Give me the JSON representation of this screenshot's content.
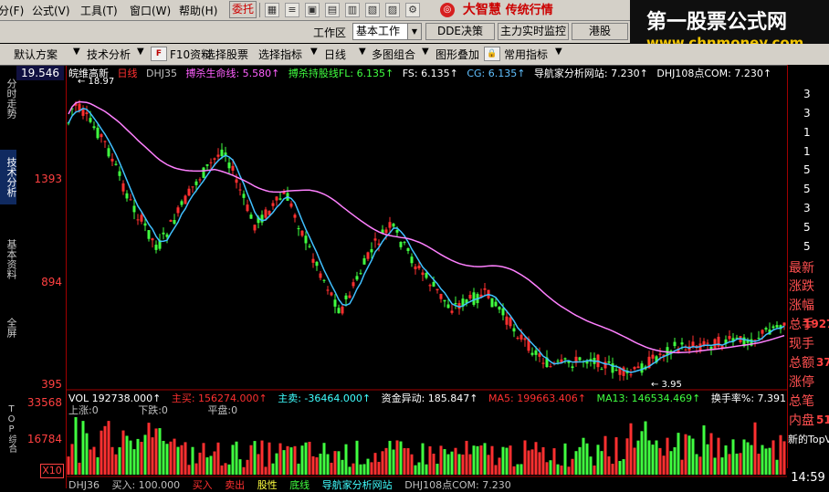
{
  "menu": {
    "items": [
      "分(F)",
      "公式(V)",
      "工具(T)",
      "窗口(W)",
      "帮助(H)"
    ],
    "commission_button": "委托",
    "brand_name": "大智慧",
    "brand_slogan": "传统行情"
  },
  "banner": {
    "title": "第一股票公式网",
    "url": "www.chnmoney.com"
  },
  "row2": {
    "workspace_label": "工作区",
    "workspace_value": "基本工作",
    "buttons": [
      "DDE决策",
      "主力实时监控",
      "港股"
    ]
  },
  "toolbar": {
    "items": [
      "默认方案",
      "技术分析",
      "F10资料",
      "选择股票",
      "选择指标",
      "日线",
      "多图组合",
      "图形叠加",
      "常用指标"
    ]
  },
  "sidebar": {
    "tabs": [
      "分时走势",
      "技术分析",
      "基本资料",
      "全屏",
      "TOP综合"
    ]
  },
  "yaxis": {
    "price_top": "19.546",
    "price_labels": [
      "1393",
      "894",
      "395"
    ],
    "vol_labels": [
      "33568",
      "16784"
    ],
    "vol_unit": "X10"
  },
  "info": {
    "stock_name": "皖维高新",
    "period": "日线",
    "indicator": "DHJ35",
    "lines": [
      {
        "text": "搏杀生命线: 5.580↑",
        "color": "#ff60ff"
      },
      {
        "text": "搏杀持股线FL: 6.135↑",
        "color": "#40ff40"
      },
      {
        "text": "FS: 6.135↑",
        "color": "#ffffff"
      },
      {
        "text": "CG: 6.135↑",
        "color": "#60c0ff"
      },
      {
        "text": "导航家分析网站: 7.230↑",
        "color": "#ffffff"
      },
      {
        "text": "DHJ108点COM: 7.230↑",
        "color": "#ffffff"
      }
    ],
    "high_marker": "18.97",
    "low_marker": "3.95"
  },
  "volume": {
    "lines": [
      {
        "text": "VOL 192738.000↑",
        "color": "#ffffff"
      },
      {
        "text": "主买: 156274.000↑",
        "color": "#ff3030"
      },
      {
        "text": "主卖: -36464.000↑",
        "color": "#40ffff"
      },
      {
        "text": "资金异动: 185.847↑",
        "color": "#ffffff"
      },
      {
        "text": "MA5: 199663.406↑",
        "color": "#ff3030"
      },
      {
        "text": "MA13: 146534.469↑",
        "color": "#40ff40"
      },
      {
        "text": "换手率%: 7.391↑",
        "color": "#ffffff"
      }
    ],
    "sub_labels": [
      "上涨:0",
      "下跌:0",
      "平盘:0"
    ]
  },
  "bottom_line": {
    "items": [
      {
        "text": "DHJ36",
        "color": "#c0c0c0"
      },
      {
        "text": "买入: 100.000",
        "color": "#c0c0c0"
      },
      {
        "text": "买入",
        "color": "#ff3030"
      },
      {
        "text": "卖出",
        "color": "#ff3030"
      },
      {
        "text": "股性",
        "color": "#ffff40"
      },
      {
        "text": "底线",
        "color": "#40ff40"
      },
      {
        "text": "导航家分析网站",
        "color": "#40ffff"
      },
      {
        "text": "DHJ108点COM: 7.230",
        "color": "#c0c0c0"
      }
    ]
  },
  "right_panel": {
    "labels": [
      "最新",
      "涨跌",
      "涨幅",
      "总手",
      "现手",
      "总额",
      "涨停",
      "总笔",
      "内盘"
    ],
    "values": [
      "1927",
      "37",
      "51"
    ],
    "digits": [
      "3",
      "3",
      "1",
      "1",
      "5",
      "3",
      "5",
      "5",
      "5"
    ],
    "news": "新的TopV",
    "time": "14:59"
  },
  "colors": {
    "up": "#ff3030",
    "down": "#40ff40",
    "ma_fast": "#40c0ff",
    "ma_slow": "#ff80ff",
    "axis": "#a00000"
  }
}
